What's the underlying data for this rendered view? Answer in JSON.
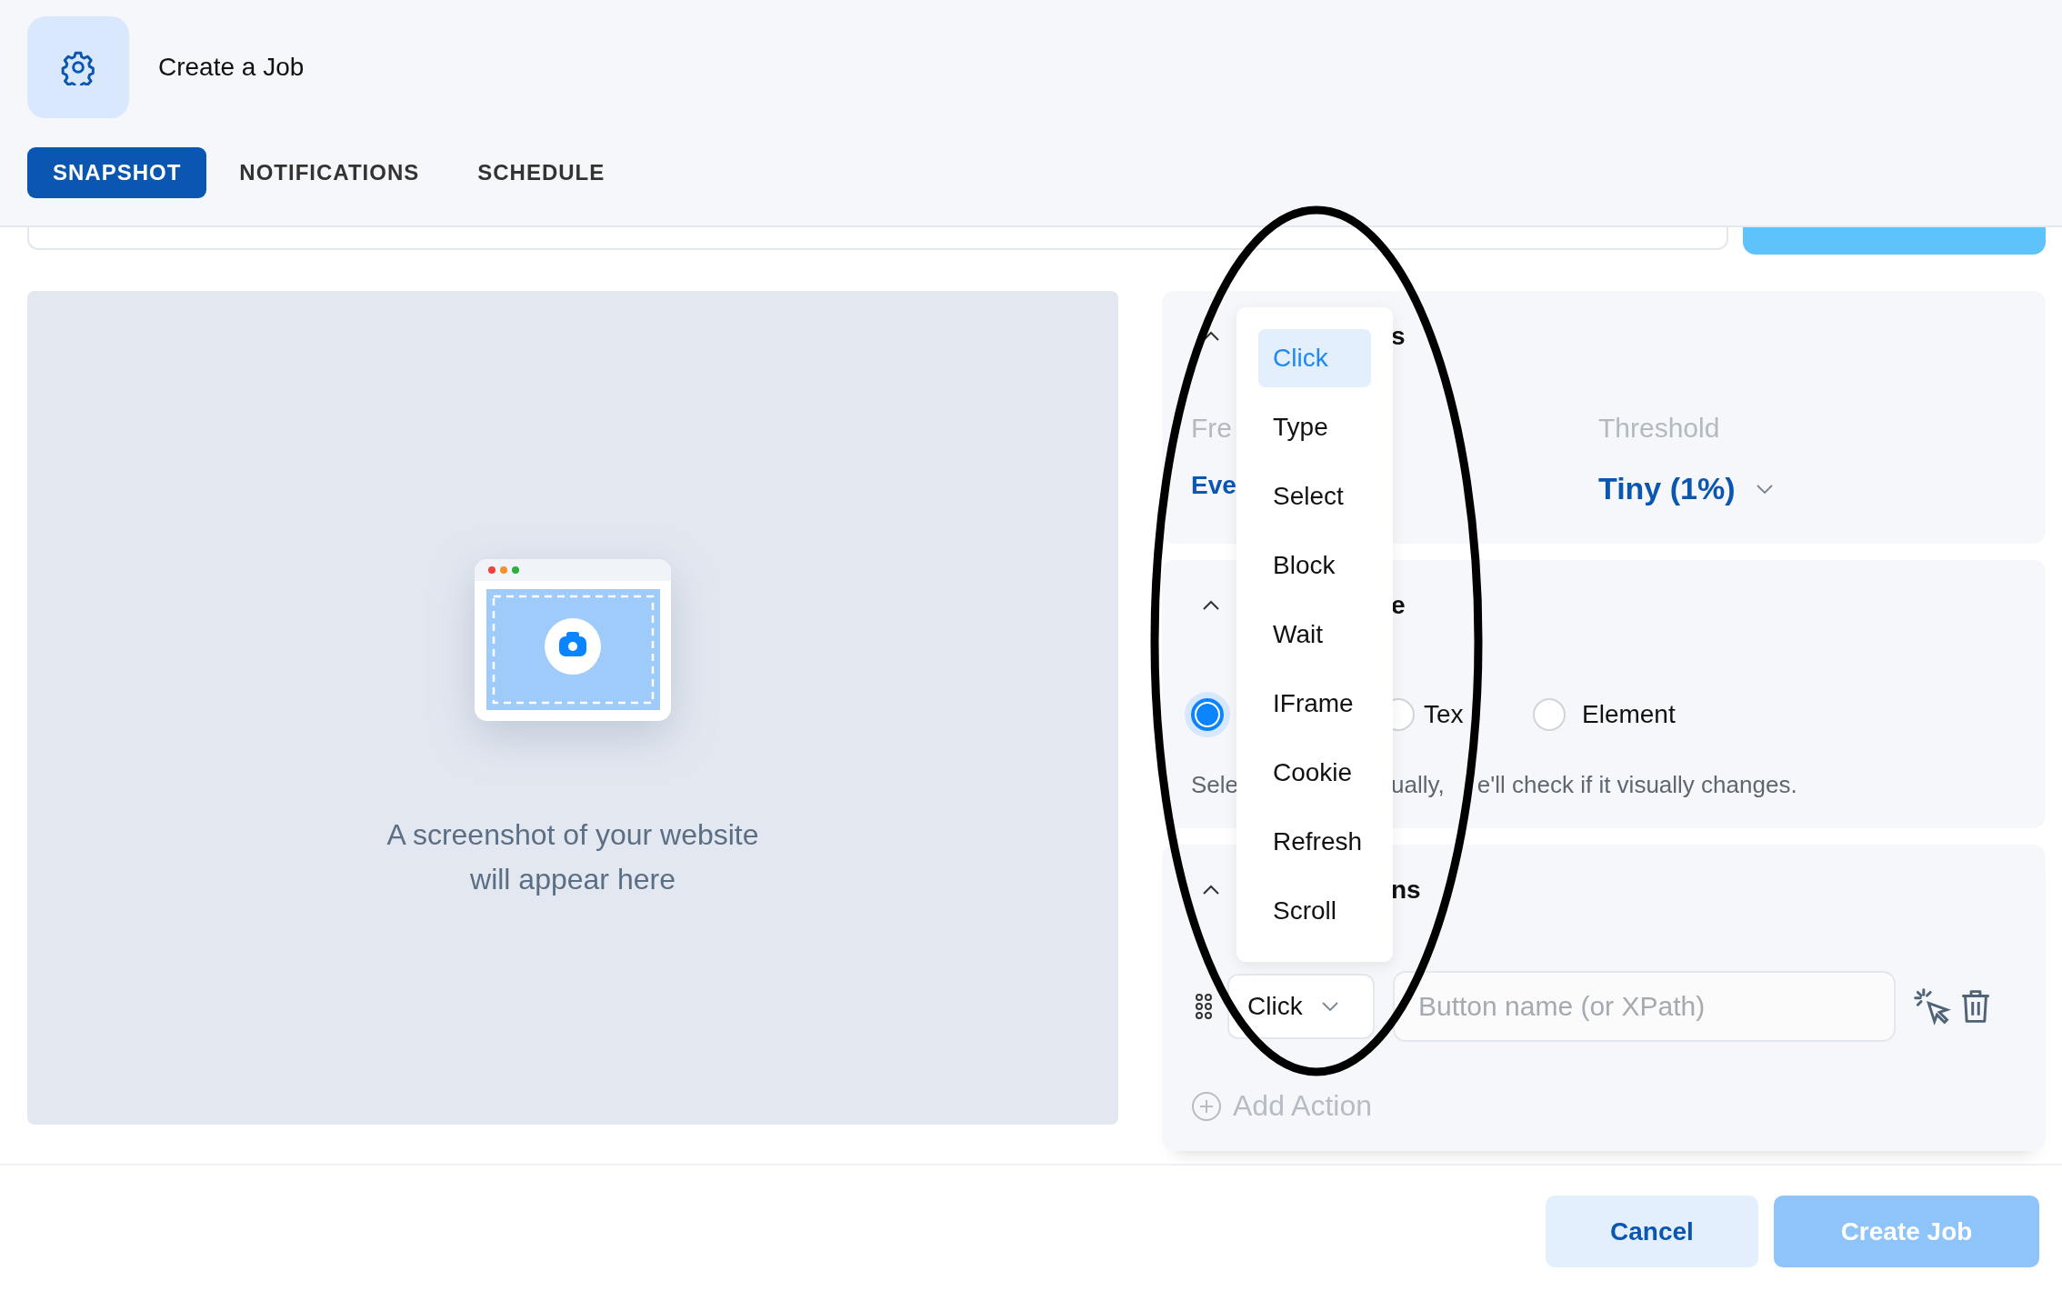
{
  "header": {
    "title": "Create a Job"
  },
  "tabs": [
    {
      "label": "SNAPSHOT",
      "selected": true
    },
    {
      "label": "NOTIFICATIONS",
      "selected": false
    },
    {
      "label": "SCHEDULE",
      "selected": false
    }
  ],
  "preview": {
    "caption_lines": [
      "A screenshot of your website",
      "will appear here"
    ]
  },
  "settings": {
    "title": "s",
    "fields": [
      {
        "label": "Fre",
        "value": "Eve",
        "kind": "text"
      },
      {
        "label": "Threshold",
        "value": "Tiny (1%)",
        "kind": "select"
      }
    ]
  },
  "type_section": {
    "title": "e",
    "options": [
      {
        "selected": true
      },
      {
        "label": "Tex",
        "selected": false
      },
      {
        "label": "Element",
        "selected": false
      }
    ],
    "description_start": "Sele",
    "description_mid": "ually,",
    "description_end": "e'll check if it visually changes."
  },
  "actions_section": {
    "title": "ns",
    "actions": [
      {
        "type": "Click",
        "placeholder": "Button name (or XPath)"
      }
    ],
    "add_label": "Add Action"
  },
  "menu": {
    "items": [
      {
        "label": "Click",
        "selected": true
      },
      {
        "label": "Type",
        "selected": false
      },
      {
        "label": "Select",
        "selected": false
      },
      {
        "label": "Block",
        "selected": false
      },
      {
        "label": "Wait",
        "selected": false
      },
      {
        "label": "IFrame",
        "selected": false
      },
      {
        "label": "Cookie",
        "selected": false
      },
      {
        "label": "Refresh",
        "selected": false
      },
      {
        "label": "Scroll",
        "selected": false
      }
    ]
  },
  "footer": {
    "buttons": [
      {
        "label": "Cancel",
        "kind": "secondary"
      },
      {
        "label": "Create Job",
        "kind": "primary"
      }
    ]
  }
}
